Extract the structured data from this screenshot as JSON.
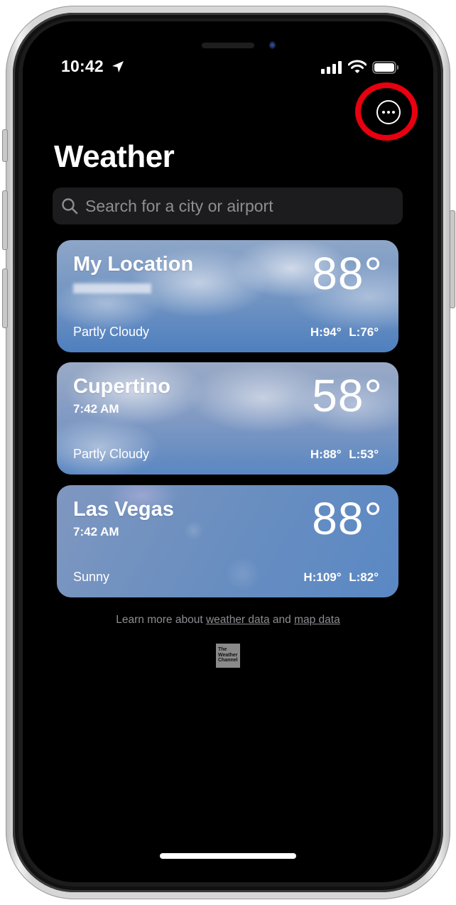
{
  "status_bar": {
    "time": "10:42",
    "location_icon": "location-arrow-icon",
    "signal_icon": "cellular-signal-icon",
    "wifi_icon": "wifi-icon",
    "battery_icon": "battery-icon"
  },
  "header": {
    "more_button_icon": "ellipsis-circle-icon",
    "title": "Weather",
    "annotation_color": "#e8000e"
  },
  "search": {
    "placeholder": "Search for a city or airport",
    "value": ""
  },
  "locations": [
    {
      "name": "My Location",
      "subtitle_redacted": true,
      "temp": "88°",
      "condition": "Partly Cloudy",
      "high_low": "H:94° L:76°"
    },
    {
      "name": "Cupertino",
      "time": "7:42 AM",
      "temp": "58°",
      "condition": "Partly Cloudy",
      "high_low": "H:88° L:53°"
    },
    {
      "name": "Las Vegas",
      "time": "7:42 AM",
      "temp": "88°",
      "condition": "Sunny",
      "high_low": "H:109° L:82°"
    }
  ],
  "footer": {
    "prefix": "Learn more about",
    "link1": "weather data",
    "middle": "and",
    "link2": "map data",
    "logo_lines": [
      "The",
      "Weather",
      "Channel"
    ]
  }
}
